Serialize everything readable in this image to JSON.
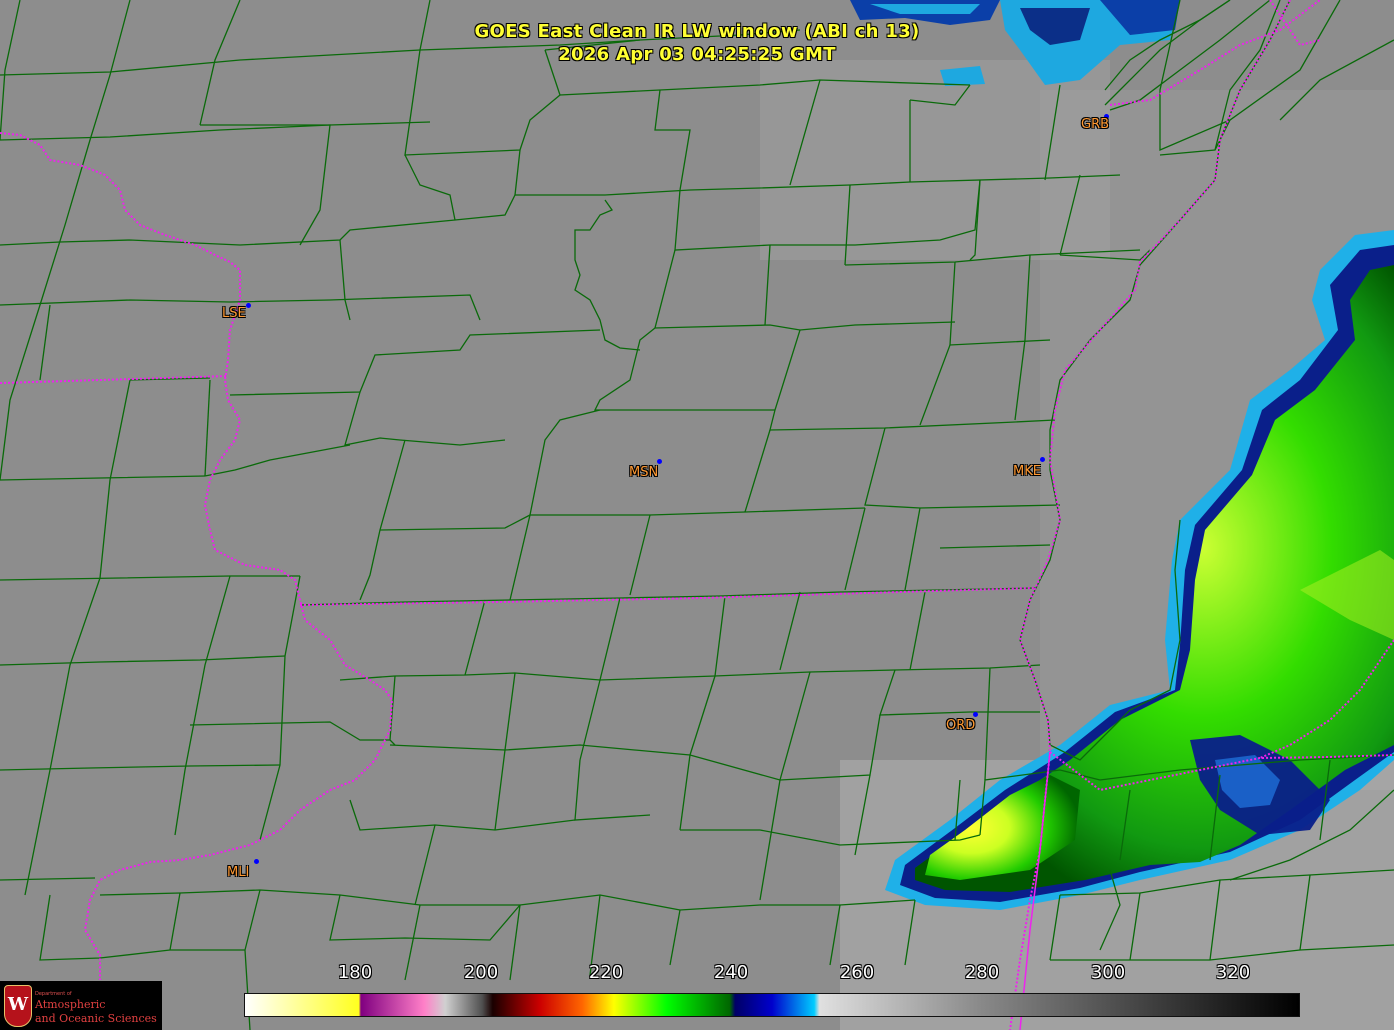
{
  "title": {
    "line1": "GOES East Clean IR LW window (ABI ch 13)",
    "line2": "2026 Apr 03  04:25:25 GMT"
  },
  "stations": [
    {
      "id": "GRB"
    },
    {
      "id": "LSE"
    },
    {
      "id": "MSN"
    },
    {
      "id": "MKE"
    },
    {
      "id": "ORD"
    },
    {
      "id": "MLI"
    }
  ],
  "colorbar": {
    "ticks": [
      "180",
      "200",
      "220",
      "240",
      "260",
      "280",
      "300",
      "320"
    ]
  },
  "logo": {
    "small": "Department of",
    "line1": "Atmospheric",
    "line2": "and Oceanic Sciences",
    "initial": "W"
  },
  "colors": {
    "title": "#ffff33",
    "station_label": "#ff9933",
    "county_lines": "#0a6a0a",
    "state_lines": "#ee22ee",
    "background_ir": "#8c8c8c"
  }
}
